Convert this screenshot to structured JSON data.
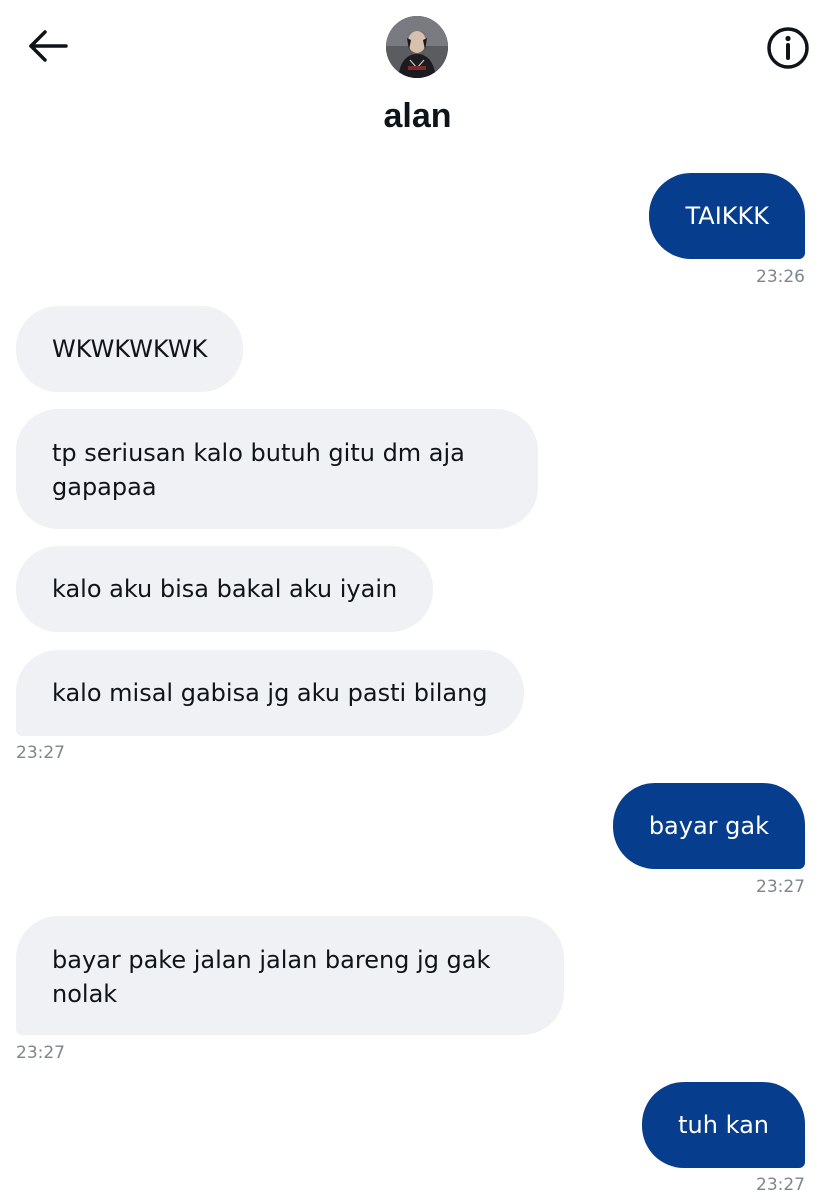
{
  "header": {
    "title": "alan",
    "back_icon": "arrow-left-icon",
    "info_icon": "info-circle-icon",
    "avatar": "avatar"
  },
  "colors": {
    "outgoing_bubble": "#063d8d",
    "incoming_bubble": "#eff1f4",
    "timestamp": "#7e868d"
  },
  "messages": [
    {
      "id": "m1",
      "direction": "outgoing",
      "text": "TAIKKK",
      "time": "23:26"
    },
    {
      "id": "m2",
      "direction": "incoming",
      "text": "WKWKWKWK"
    },
    {
      "id": "m3",
      "direction": "incoming",
      "text": "tp seriusan kalo butuh gitu dm aja gapapaa"
    },
    {
      "id": "m4",
      "direction": "incoming",
      "text": "kalo aku bisa bakal aku iyain"
    },
    {
      "id": "m5",
      "direction": "incoming",
      "text": "kalo misal gabisa jg aku pasti bilang",
      "time": "23:27"
    },
    {
      "id": "m6",
      "direction": "outgoing",
      "text": "bayar gak",
      "time": "23:27"
    },
    {
      "id": "m7",
      "direction": "incoming",
      "text": "bayar pake jalan jalan bareng jg gak nolak",
      "time": "23:27"
    },
    {
      "id": "m8",
      "direction": "outgoing",
      "text": "tuh kan",
      "time": "23:27"
    }
  ]
}
